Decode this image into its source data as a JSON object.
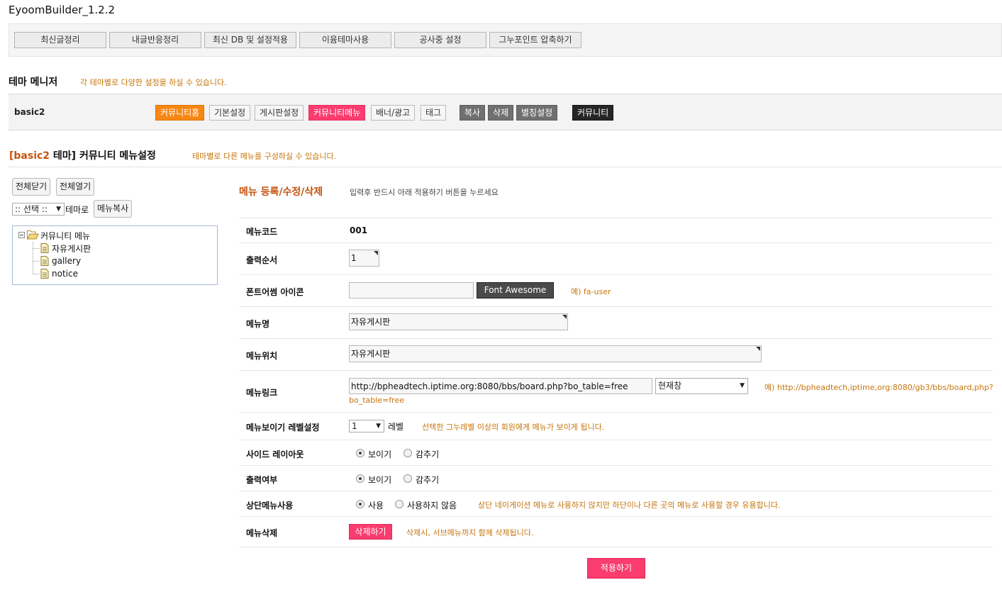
{
  "app_title": "EyoomBuilder_1.2.2",
  "toolbar": {
    "buttons": [
      "최신글정리",
      "내글반응정리",
      "최신 DB 및 설정적용",
      "이윰테마사용",
      "공사중 설정",
      "그누포인트 압축하기"
    ]
  },
  "theme_manager": {
    "title": "테마 메니저",
    "note": "각 테마별로 다양한 설정을 하실 수 있습니다.",
    "theme_name": "basic2",
    "tabs": [
      "커뮤니티홈",
      "기본설정",
      "게시판설정",
      "커뮤니티메뉴",
      "배너/광고",
      "태그"
    ],
    "actions": [
      "복사",
      "삭제",
      "별칭설정"
    ],
    "community_button": "커뮤니티"
  },
  "page": {
    "title_bracket_open": "[",
    "title_theme": "basic2",
    "title_rest": " 테마] 커뮤니티 메뉴설정",
    "note": "테마별로 다른 메뉴를 구성하실 수 있습니다."
  },
  "sidebar": {
    "close_all": "전체닫기",
    "open_all": "전체열기",
    "theme_select": ":: 선택 ::",
    "theme_suffix": "테마로",
    "copy_menu": "메뉴복사",
    "tree": {
      "root": "커뮤니티 메뉴",
      "children": [
        "자유게시판",
        "gallery",
        "notice"
      ]
    }
  },
  "form": {
    "title": "메뉴 등록/수정/삭제",
    "hint": "입력후 반드시 아래 적용하기 버튼을 누르세요",
    "menu_code": {
      "label": "메뉴코드",
      "value": "001"
    },
    "order": {
      "label": "출력순서",
      "value": "1"
    },
    "icon": {
      "label": "폰트어썸 아이콘",
      "value": "",
      "button": "Font Awesome",
      "example": "예) fa-user"
    },
    "name": {
      "label": "메뉴명",
      "value": "자유게시판"
    },
    "location": {
      "label": "메뉴위치",
      "value": "자유게시판"
    },
    "link": {
      "label": "메뉴링크",
      "value": "http://bpheadtech.iptime.org:8080/bbs/board.php?bo_table=free",
      "target": "현재창",
      "example_line1": "예) http://bpheadtech,iptime,org:8080/gb3/bbs/board,php?",
      "example_line2": "bo_table=free"
    },
    "level": {
      "label": "메뉴보이기 레벨설정",
      "value": "1",
      "suffix": "레벨",
      "note": "선택한 그누레벨 이상의 회원에게 메뉴가 보이게 됩니다."
    },
    "side_layout": {
      "label": "사이드 레이아웃",
      "options": [
        "보이기",
        "감추기"
      ],
      "selected": "보이기"
    },
    "display": {
      "label": "출력여부",
      "options": [
        "보이기",
        "감추기"
      ],
      "selected": "보이기"
    },
    "top_menu": {
      "label": "상단메뉴사용",
      "options": [
        "사용",
        "사용하지 않음"
      ],
      "selected": "사용",
      "note": "상단 네이게이션 메뉴로 사용하지 않지만 하단이나 다른 곳의 메뉴로 사용할 경우 유용합니다."
    },
    "delete": {
      "label": "메뉴삭제",
      "button": "삭제하기",
      "note": "삭제시, 서브메뉴까지 함께 삭제됩니다."
    },
    "apply": "적용하기"
  },
  "colors": {
    "accent_orange": "#f68713",
    "accent_pink": "#fb3c6f",
    "note_text": "#c6740b",
    "title_text": "#c6530d"
  }
}
